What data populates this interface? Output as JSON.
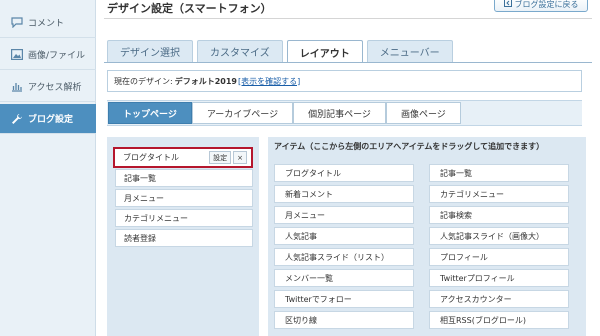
{
  "sidebar": {
    "items": [
      {
        "label": "コメント",
        "icon": "comment-icon"
      },
      {
        "label": "画像/ファイル",
        "icon": "image-icon"
      },
      {
        "label": "アクセス解析",
        "icon": "chart-icon"
      },
      {
        "label": "ブログ設定",
        "icon": "wrench-icon",
        "active": true
      }
    ]
  },
  "header": {
    "title": "デザイン設定（スマートフォン）",
    "back_label": "ブログ設定に戻る"
  },
  "tabs": [
    "デザイン選択",
    "カスタマイズ",
    "レイアウト",
    "メニューバー"
  ],
  "active_tab": "レイアウト",
  "current_design": {
    "prefix": "現在のデザイン:",
    "name": "デフォルト2019",
    "link": "[表示を確認する]"
  },
  "subtabs": [
    "トップページ",
    "アーカイブページ",
    "個別記事ページ",
    "画像ページ"
  ],
  "active_subtab": "トップページ",
  "layout": {
    "items": [
      {
        "label": "ブログタイトル",
        "selected": true,
        "settings_label": "設定",
        "close_label": "×"
      },
      {
        "label": "記事一覧"
      },
      {
        "label": "月メニュー"
      },
      {
        "label": "カテゴリメニュー"
      },
      {
        "label": "読者登録"
      }
    ]
  },
  "items_panel": {
    "header": "アイテム（ここから左側のエリアへアイテムをドラッグして追加できます）",
    "items": [
      "ブログタイトル",
      "記事一覧",
      "新着コメント",
      "カテゴリメニュー",
      "月メニュー",
      "記事検索",
      "人気記事",
      "人気記事スライド（画像大）",
      "人気記事スライド（リスト）",
      "プロフィール",
      "メンバー一覧",
      "Twitterプロフィール",
      "Twitterでフォロー",
      "アクセスカウンター",
      "区切り線",
      "相互RSS(ブログロール)"
    ]
  },
  "colors": {
    "accent": "#4d8fbf",
    "highlight_border": "#b5162d",
    "panel_bg": "#dce8f2"
  }
}
